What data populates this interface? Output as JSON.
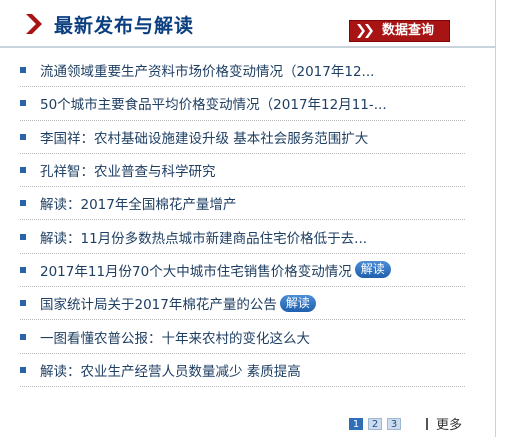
{
  "header": {
    "title": "最新发布与解读",
    "query_button_label": "数据查询"
  },
  "colors": {
    "title": "#0b3f80",
    "accent_red": "#a81313",
    "link": "#1f3f63",
    "badge_blue": "#2b6cb3"
  },
  "news": [
    {
      "text": "流通领域重要生产资料市场价格变动情况（2017年12...",
      "badge": ""
    },
    {
      "text": "50个城市主要食品平均价格变动情况（2017年12月11-...",
      "badge": ""
    },
    {
      "text": "李国祥：农村基础设施建设升级 基本社会服务范围扩大",
      "badge": ""
    },
    {
      "text": "孔祥智：农业普查与科学研究",
      "badge": ""
    },
    {
      "text": "解读：2017年全国棉花产量增产",
      "badge": ""
    },
    {
      "text": "解读：11月份多数热点城市新建商品住宅价格低于去...",
      "badge": ""
    },
    {
      "text": "2017年11月份70个大中城市住宅销售价格变动情况",
      "badge": "解读"
    },
    {
      "text": "国家统计局关于2017年棉花产量的公告",
      "badge": "解读"
    },
    {
      "text": "一图看懂农普公报：十年来农村的变化这么大",
      "badge": ""
    },
    {
      "text": "解读：农业生产经营人员数量减少 素质提高",
      "badge": ""
    }
  ],
  "pagination": {
    "pages": [
      "1",
      "2",
      "3"
    ],
    "current": "1",
    "more_label": "更多"
  }
}
